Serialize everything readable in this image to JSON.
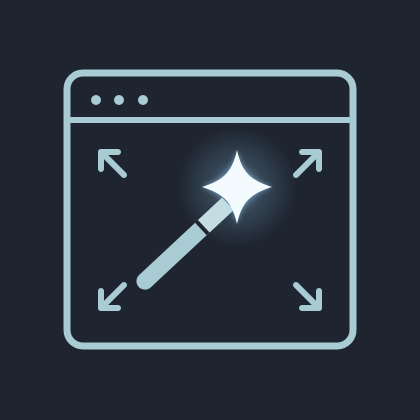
{
  "icon": {
    "name": "magic-resize-window-icon",
    "parts": [
      "window-frame-icon",
      "window-control-dots-icon",
      "expand-arrow-top-left-icon",
      "expand-arrow-top-right-icon",
      "expand-arrow-bottom-left-icon",
      "expand-arrow-bottom-right-icon",
      "magic-wand-icon",
      "sparkle-icon"
    ]
  },
  "colors": {
    "background": "#1e2530",
    "stroke": "#a9cbd3",
    "sparkle": "#f4fbff",
    "glow": "#9fd8ff"
  }
}
